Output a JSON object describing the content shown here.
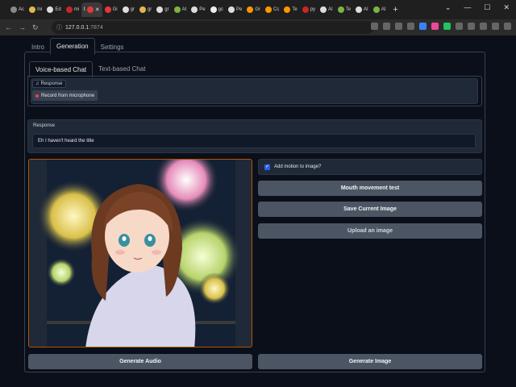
{
  "browser": {
    "tabs": [
      {
        "label": "Ac"
      },
      {
        "label": "Ini"
      },
      {
        "label": "Ed"
      },
      {
        "label": "mi"
      },
      {
        "label": "t"
      },
      {
        "label": "Gi"
      },
      {
        "label": "gr"
      },
      {
        "label": "gr"
      },
      {
        "label": "gr"
      },
      {
        "label": "AI"
      },
      {
        "label": "Pe"
      },
      {
        "label": "gc"
      },
      {
        "label": "Pe"
      },
      {
        "label": "Gr"
      },
      {
        "label": "Cc"
      },
      {
        "label": "Te"
      },
      {
        "label": "py"
      },
      {
        "label": "AI"
      },
      {
        "label": "Te"
      },
      {
        "label": "AI"
      },
      {
        "label": "AI"
      }
    ],
    "url_host": "127.0.0.1",
    "url_port": ":7874"
  },
  "app": {
    "top_tabs": {
      "intro": "Intro",
      "generation": "Generation",
      "settings": "Settings"
    },
    "sub_tabs": {
      "voice": "Voice-based Chat",
      "text": "Text-based Chat"
    },
    "audio_label": "Response",
    "record_button": "Record from microphone",
    "response_label": "Response",
    "response_value": "Eh I haven't heard the title",
    "motion_checkbox": "Add motion to image?",
    "buttons": {
      "mouth_test": "Mouth movement test",
      "save_image": "Save Current Image",
      "upload_image": "Upload an image",
      "generate_audio": "Generate Audio",
      "generate_image": "Generate Image"
    }
  },
  "colors": {
    "accent": "#2563eb",
    "button": "#4b5563",
    "image_border": "#b45309"
  }
}
